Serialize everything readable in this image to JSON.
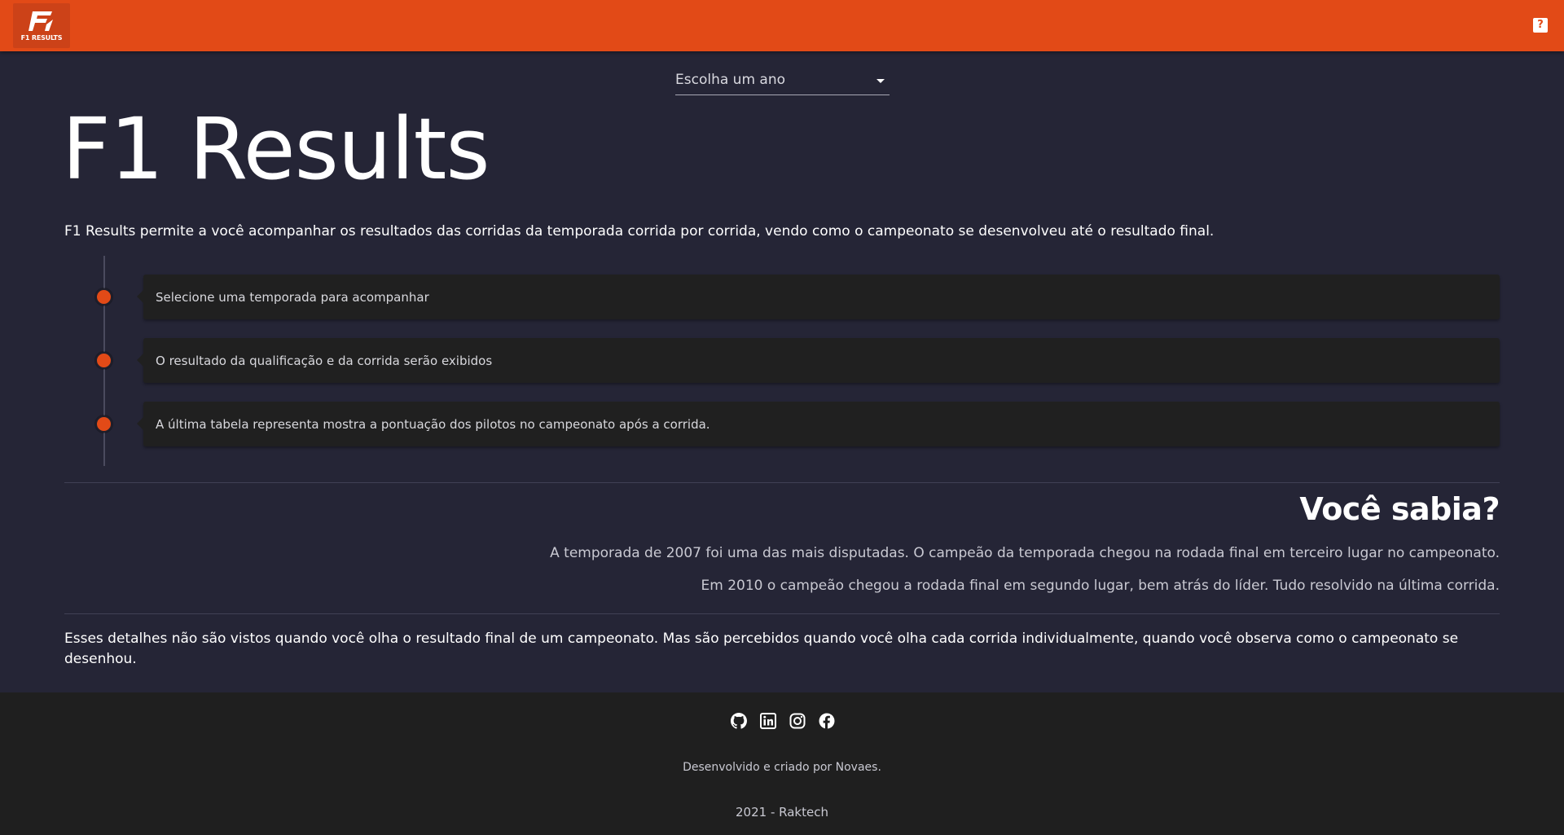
{
  "header": {
    "logo_text": "F1 RESULTS",
    "help_icon": "question-mark-icon",
    "help_label": "?"
  },
  "year_select": {
    "placeholder": "Escolha um ano"
  },
  "main": {
    "title": "F1 Results",
    "intro": "F1 Results permite a você acompanhar os resultados das corridas da temporada corrida por corrida, vendo como o campeonato se desenvolveu até o resultado final.",
    "steps": [
      "Selecione uma temporada para acompanhar",
      "O resultado da qualificação e da corrida serão exibidos",
      "A última tabela representa mostra a pontuação dos pilotos no campeonato após a corrida."
    ],
    "fact_title": "Você sabia?",
    "facts": [
      "A temporada de 2007 foi uma das mais disputadas. O campeão da temporada chegou na rodada final em terceiro lugar no campeonato.",
      "Em 2010 o campeão chegou a rodada final em segundo lugar, bem atrás do líder. Tudo resolvido na última corrida."
    ],
    "outro": "Esses detalhes não são vistos quando você olha o resultado final de um campeonato. Mas são percebidos quando você olha cada corrida individualmente, quando você observa como o campeonato se desenhou."
  },
  "footer": {
    "socials": [
      "github-icon",
      "linkedin-icon",
      "instagram-icon",
      "facebook-icon"
    ],
    "credit": "Desenvolvido e criado por Novaes.",
    "copyright": "2021 - Raktech"
  },
  "colors": {
    "accent": "#e24a17",
    "background": "#252536",
    "card": "#202020",
    "footer": "#1f1f1f"
  }
}
